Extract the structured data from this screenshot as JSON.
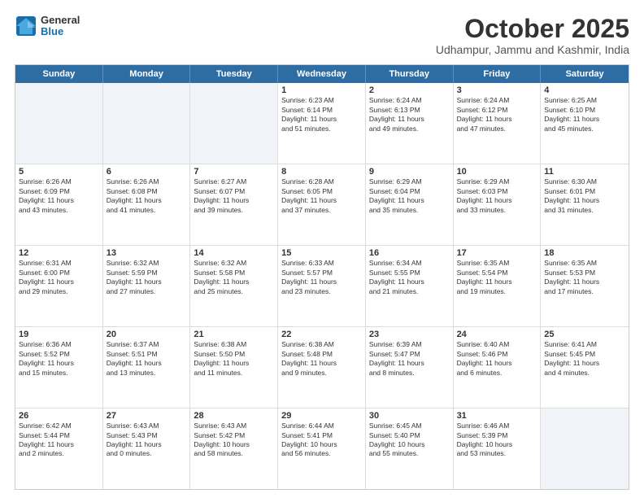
{
  "logo": {
    "general": "General",
    "blue": "Blue"
  },
  "header": {
    "month": "October 2025",
    "location": "Udhampur, Jammu and Kashmir, India"
  },
  "days": [
    "Sunday",
    "Monday",
    "Tuesday",
    "Wednesday",
    "Thursday",
    "Friday",
    "Saturday"
  ],
  "weeks": [
    [
      {
        "day": "",
        "text": ""
      },
      {
        "day": "",
        "text": ""
      },
      {
        "day": "",
        "text": ""
      },
      {
        "day": "1",
        "text": "Sunrise: 6:23 AM\nSunset: 6:14 PM\nDaylight: 11 hours\nand 51 minutes."
      },
      {
        "day": "2",
        "text": "Sunrise: 6:24 AM\nSunset: 6:13 PM\nDaylight: 11 hours\nand 49 minutes."
      },
      {
        "day": "3",
        "text": "Sunrise: 6:24 AM\nSunset: 6:12 PM\nDaylight: 11 hours\nand 47 minutes."
      },
      {
        "day": "4",
        "text": "Sunrise: 6:25 AM\nSunset: 6:10 PM\nDaylight: 11 hours\nand 45 minutes."
      }
    ],
    [
      {
        "day": "5",
        "text": "Sunrise: 6:26 AM\nSunset: 6:09 PM\nDaylight: 11 hours\nand 43 minutes."
      },
      {
        "day": "6",
        "text": "Sunrise: 6:26 AM\nSunset: 6:08 PM\nDaylight: 11 hours\nand 41 minutes."
      },
      {
        "day": "7",
        "text": "Sunrise: 6:27 AM\nSunset: 6:07 PM\nDaylight: 11 hours\nand 39 minutes."
      },
      {
        "day": "8",
        "text": "Sunrise: 6:28 AM\nSunset: 6:05 PM\nDaylight: 11 hours\nand 37 minutes."
      },
      {
        "day": "9",
        "text": "Sunrise: 6:29 AM\nSunset: 6:04 PM\nDaylight: 11 hours\nand 35 minutes."
      },
      {
        "day": "10",
        "text": "Sunrise: 6:29 AM\nSunset: 6:03 PM\nDaylight: 11 hours\nand 33 minutes."
      },
      {
        "day": "11",
        "text": "Sunrise: 6:30 AM\nSunset: 6:01 PM\nDaylight: 11 hours\nand 31 minutes."
      }
    ],
    [
      {
        "day": "12",
        "text": "Sunrise: 6:31 AM\nSunset: 6:00 PM\nDaylight: 11 hours\nand 29 minutes."
      },
      {
        "day": "13",
        "text": "Sunrise: 6:32 AM\nSunset: 5:59 PM\nDaylight: 11 hours\nand 27 minutes."
      },
      {
        "day": "14",
        "text": "Sunrise: 6:32 AM\nSunset: 5:58 PM\nDaylight: 11 hours\nand 25 minutes."
      },
      {
        "day": "15",
        "text": "Sunrise: 6:33 AM\nSunset: 5:57 PM\nDaylight: 11 hours\nand 23 minutes."
      },
      {
        "day": "16",
        "text": "Sunrise: 6:34 AM\nSunset: 5:55 PM\nDaylight: 11 hours\nand 21 minutes."
      },
      {
        "day": "17",
        "text": "Sunrise: 6:35 AM\nSunset: 5:54 PM\nDaylight: 11 hours\nand 19 minutes."
      },
      {
        "day": "18",
        "text": "Sunrise: 6:35 AM\nSunset: 5:53 PM\nDaylight: 11 hours\nand 17 minutes."
      }
    ],
    [
      {
        "day": "19",
        "text": "Sunrise: 6:36 AM\nSunset: 5:52 PM\nDaylight: 11 hours\nand 15 minutes."
      },
      {
        "day": "20",
        "text": "Sunrise: 6:37 AM\nSunset: 5:51 PM\nDaylight: 11 hours\nand 13 minutes."
      },
      {
        "day": "21",
        "text": "Sunrise: 6:38 AM\nSunset: 5:50 PM\nDaylight: 11 hours\nand 11 minutes."
      },
      {
        "day": "22",
        "text": "Sunrise: 6:38 AM\nSunset: 5:48 PM\nDaylight: 11 hours\nand 9 minutes."
      },
      {
        "day": "23",
        "text": "Sunrise: 6:39 AM\nSunset: 5:47 PM\nDaylight: 11 hours\nand 8 minutes."
      },
      {
        "day": "24",
        "text": "Sunrise: 6:40 AM\nSunset: 5:46 PM\nDaylight: 11 hours\nand 6 minutes."
      },
      {
        "day": "25",
        "text": "Sunrise: 6:41 AM\nSunset: 5:45 PM\nDaylight: 11 hours\nand 4 minutes."
      }
    ],
    [
      {
        "day": "26",
        "text": "Sunrise: 6:42 AM\nSunset: 5:44 PM\nDaylight: 11 hours\nand 2 minutes."
      },
      {
        "day": "27",
        "text": "Sunrise: 6:43 AM\nSunset: 5:43 PM\nDaylight: 11 hours\nand 0 minutes."
      },
      {
        "day": "28",
        "text": "Sunrise: 6:43 AM\nSunset: 5:42 PM\nDaylight: 10 hours\nand 58 minutes."
      },
      {
        "day": "29",
        "text": "Sunrise: 6:44 AM\nSunset: 5:41 PM\nDaylight: 10 hours\nand 56 minutes."
      },
      {
        "day": "30",
        "text": "Sunrise: 6:45 AM\nSunset: 5:40 PM\nDaylight: 10 hours\nand 55 minutes."
      },
      {
        "day": "31",
        "text": "Sunrise: 6:46 AM\nSunset: 5:39 PM\nDaylight: 10 hours\nand 53 minutes."
      },
      {
        "day": "",
        "text": ""
      }
    ]
  ]
}
